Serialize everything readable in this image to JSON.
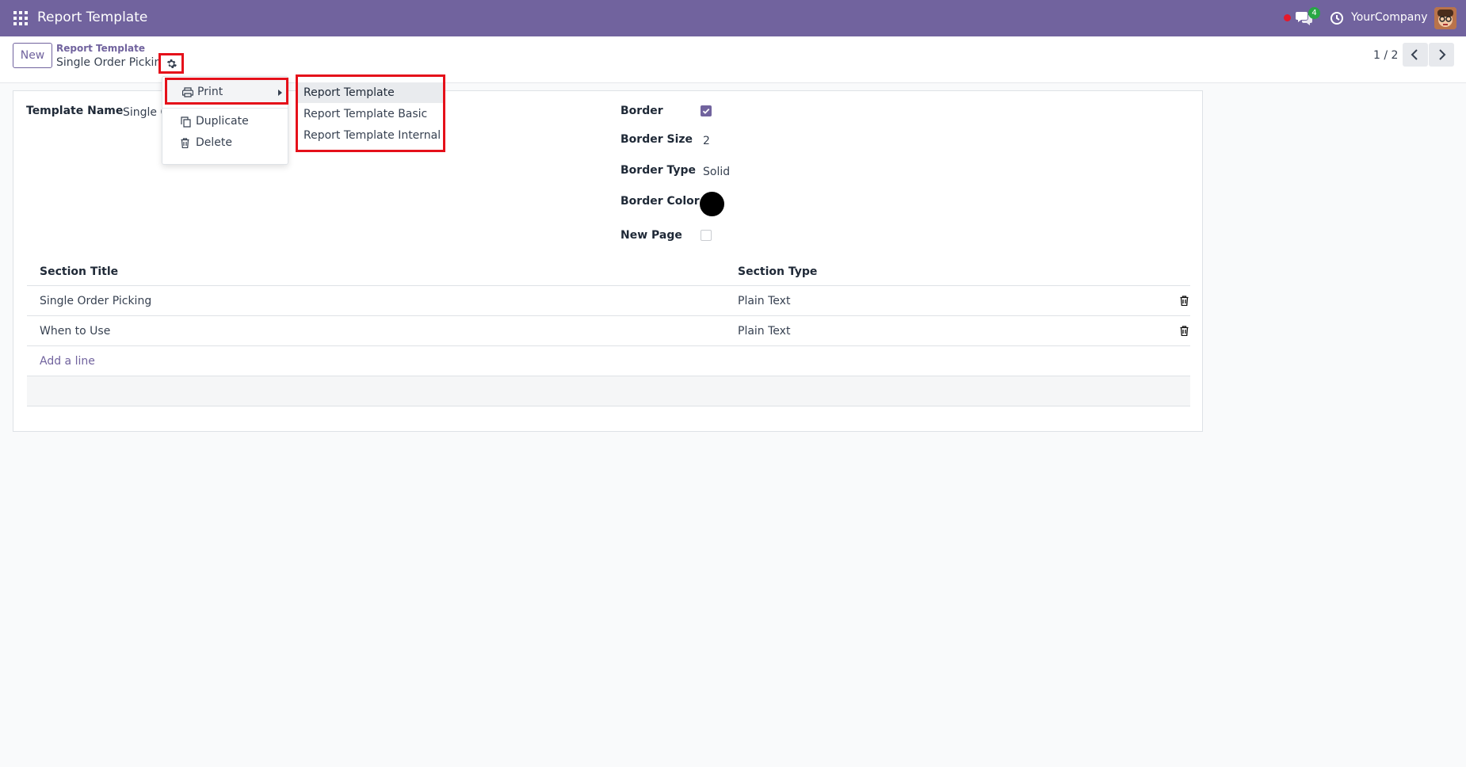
{
  "navbar": {
    "app_title": "Report Template",
    "notification_count": "4",
    "company": "YourCompany"
  },
  "control_panel": {
    "new_label": "New",
    "breadcrumb_parent": "Report Template",
    "breadcrumb_current": "Single Order Picking",
    "pager_value": "1 / 2"
  },
  "actions_menu": {
    "print_label": "Print",
    "duplicate_label": "Duplicate",
    "delete_label": "Delete",
    "print_submenu": [
      "Report Template",
      "Report Template Basic",
      "Report Template Internal"
    ]
  },
  "form": {
    "template_name_label": "Template Name",
    "template_name_value": "Single C",
    "border_label": "Border",
    "border_checked": true,
    "border_size_label": "Border Size",
    "border_size_value": "2",
    "border_type_label": "Border Type",
    "border_type_value": "Solid",
    "border_color_label": "Border Color",
    "border_color_value": "#000000",
    "new_page_label": "New Page",
    "new_page_checked": false
  },
  "sections": {
    "col_title": "Section Title",
    "col_type": "Section Type",
    "rows": [
      {
        "title": "Single Order Picking",
        "type": "Plain Text"
      },
      {
        "title": "When to Use",
        "type": "Plain Text"
      }
    ],
    "add_line_label": "Add a line"
  },
  "colors": {
    "brand": "#71639e",
    "highlight": "#e5101a"
  }
}
